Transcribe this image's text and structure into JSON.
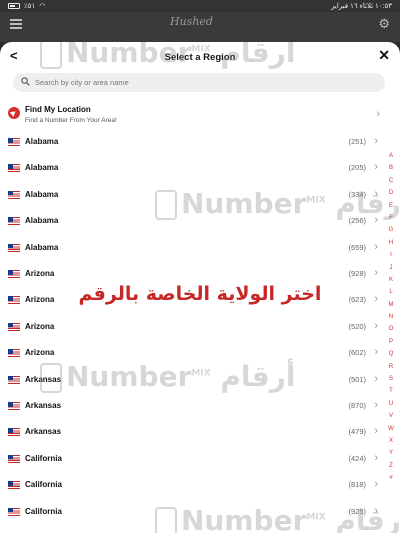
{
  "status": {
    "battery": "٪٥١",
    "datetime": "١٠:٥٣ ثلاثاء ١٦ فبراير"
  },
  "app": {
    "logo": "Hushed"
  },
  "modal": {
    "title": "Select a Region",
    "search_placeholder": "Search by city or area name",
    "find_location": {
      "title": "Find My Location",
      "subtitle": "Find a Number From Your Area!"
    }
  },
  "regions": [
    {
      "name": "Alabama",
      "code": "(251)"
    },
    {
      "name": "Alabama",
      "code": "(205)"
    },
    {
      "name": "Alabama",
      "code": "(334)"
    },
    {
      "name": "Alabama",
      "code": "(256)"
    },
    {
      "name": "Alabama",
      "code": "(659)"
    },
    {
      "name": "Arizona",
      "code": "(928)"
    },
    {
      "name": "Arizona",
      "code": "(623)"
    },
    {
      "name": "Arizona",
      "code": "(520)"
    },
    {
      "name": "Arizona",
      "code": "(602)"
    },
    {
      "name": "Arkansas",
      "code": "(501)"
    },
    {
      "name": "Arkansas",
      "code": "(870)"
    },
    {
      "name": "Arkansas",
      "code": "(479)"
    },
    {
      "name": "California",
      "code": "(424)"
    },
    {
      "name": "California",
      "code": "(818)"
    },
    {
      "name": "California",
      "code": "(925)"
    }
  ],
  "alphabet": [
    "A",
    "B",
    "C",
    "D",
    "E",
    "F",
    "G",
    "H",
    "I",
    "J",
    "K",
    "L",
    "M",
    "N",
    "O",
    "P",
    "Q",
    "R",
    "S",
    "T",
    "U",
    "V",
    "W",
    "X",
    "Y",
    "Z",
    "#"
  ],
  "overlay_caption": "اختر الولاية الخاصة بالرقم",
  "watermark": {
    "text": "Number",
    "sup": "MIX",
    "arabic": "أرقام"
  },
  "colors": {
    "accent": "#d32f2f",
    "sheet": "#ffffff",
    "backdrop": "#2b2b2b"
  }
}
